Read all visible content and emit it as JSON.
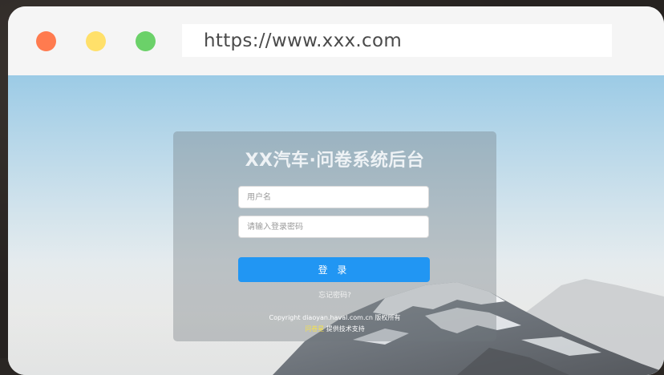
{
  "browser": {
    "url": "https://www.xxx.com",
    "controls": [
      "close",
      "minimize",
      "maximize"
    ]
  },
  "login": {
    "title": "XX汽车·问卷系统后台",
    "username_placeholder": "用户名",
    "password_placeholder": "请输入登录密码",
    "submit_label": "登 录",
    "forgot_label": "忘记密码?"
  },
  "footer": {
    "copyright": "Copyright  diaoyan.haval.com.cn  版权所有",
    "support_brand": "问卷星",
    "support_text": " 提供技术支持"
  },
  "colors": {
    "close": "#ff7b4f",
    "minimize": "#ffe06a",
    "maximize": "#6bd169",
    "accent": "#2196f3"
  }
}
